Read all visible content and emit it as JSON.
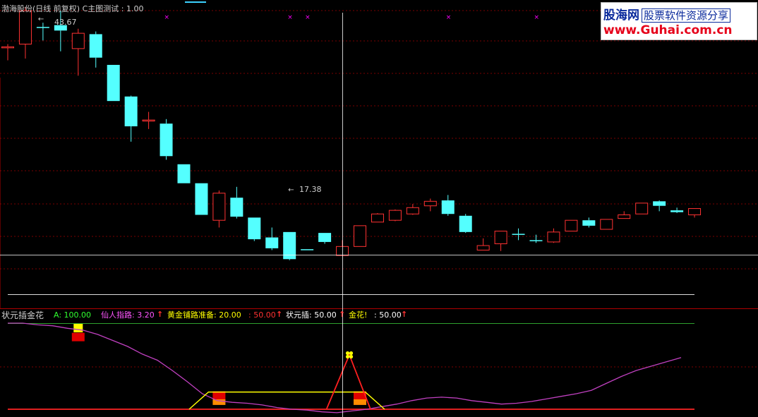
{
  "main_title": "渤海股份(日线 前复权) C主图测试 : 1.00",
  "high_label": "43.67",
  "low_label": "17.38",
  "indicator": {
    "name": "状元插金花",
    "a_label": "A: 100.00",
    "xianren_label": "仙人指路: 3.20",
    "huangjin_label": "黄金铺路准备: 20.00",
    "huangjin_val2": ": 50.00",
    "zhuangyuan_label": "状元插: 50.00",
    "jinhua_label": "金花!",
    "jinhua_val": ": 50.00"
  },
  "logo": {
    "brand": "股海网",
    "slogan": "股票软件资源分享",
    "url": "www.Guhai.com.cn"
  },
  "colors": {
    "up": "#ff3232",
    "down": "#54ffff",
    "grid": "#7a0000",
    "crosshair": "#ffffff",
    "magenta": "#ff00ff",
    "yellow": "#ffff00"
  },
  "chart_data": {
    "type": "candlestick",
    "price_range": [
      12.6,
      45.4
    ],
    "candles": [
      {
        "o": 41.0,
        "c": 41.0,
        "h": 41.3,
        "l": 39.5,
        "dir": "up"
      },
      {
        "o": 41.3,
        "c": 45.0,
        "h": 45.4,
        "l": 39.7,
        "dir": "up"
      },
      {
        "o": 43.2,
        "c": 43.2,
        "h": 43.67,
        "l": 41.7,
        "dir": "down"
      },
      {
        "o": 43.4,
        "c": 42.8,
        "h": 45.0,
        "l": 40.5,
        "dir": "down"
      },
      {
        "o": 40.8,
        "c": 42.5,
        "h": 43.0,
        "l": 37.8,
        "dir": "up"
      },
      {
        "o": 42.4,
        "c": 39.8,
        "h": 42.7,
        "l": 38.7,
        "dir": "down"
      },
      {
        "o": 39.0,
        "c": 35.0,
        "h": 39.0,
        "l": 35.0,
        "dir": "down"
      },
      {
        "o": 35.5,
        "c": 32.2,
        "h": 35.6,
        "l": 30.5,
        "dir": "down"
      },
      {
        "o": 32.9,
        "c": 32.9,
        "h": 33.8,
        "l": 31.9,
        "dir": "up"
      },
      {
        "o": 32.5,
        "c": 28.9,
        "h": 33.0,
        "l": 28.5,
        "dir": "down"
      },
      {
        "o": 28.0,
        "c": 25.9,
        "h": 28.0,
        "l": 25.9,
        "dir": "down"
      },
      {
        "o": 25.9,
        "c": 22.4,
        "h": 25.9,
        "l": 22.4,
        "dir": "down"
      },
      {
        "o": 21.8,
        "c": 24.8,
        "h": 25.1,
        "l": 21.0,
        "dir": "up"
      },
      {
        "o": 24.3,
        "c": 22.2,
        "h": 25.5,
        "l": 22.0,
        "dir": "down"
      },
      {
        "o": 22.1,
        "c": 19.7,
        "h": 22.1,
        "l": 19.5,
        "dir": "down"
      },
      {
        "o": 19.9,
        "c": 18.7,
        "h": 21.0,
        "l": 18.5,
        "dir": "down"
      },
      {
        "o": 20.5,
        "c": 17.5,
        "h": 20.5,
        "l": 17.38,
        "dir": "down"
      },
      {
        "o": 18.6,
        "c": 18.6,
        "h": 18.6,
        "l": 18.6,
        "dir": "down"
      },
      {
        "o": 20.4,
        "c": 19.4,
        "h": 20.4,
        "l": 19.2,
        "dir": "down"
      },
      {
        "o": 17.9,
        "c": 18.9,
        "h": 19.6,
        "l": 17.9,
        "dir": "up"
      },
      {
        "o": 18.9,
        "c": 21.2,
        "h": 21.2,
        "l": 18.9,
        "dir": "up"
      },
      {
        "o": 21.6,
        "c": 22.5,
        "h": 22.6,
        "l": 21.6,
        "dir": "up"
      },
      {
        "o": 21.8,
        "c": 22.9,
        "h": 23.0,
        "l": 21.7,
        "dir": "up"
      },
      {
        "o": 22.5,
        "c": 23.2,
        "h": 23.6,
        "l": 22.4,
        "dir": "up"
      },
      {
        "o": 23.4,
        "c": 23.9,
        "h": 24.2,
        "l": 22.8,
        "dir": "up"
      },
      {
        "o": 24.0,
        "c": 22.5,
        "h": 24.6,
        "l": 22.3,
        "dir": "down"
      },
      {
        "o": 22.3,
        "c": 20.5,
        "h": 22.5,
        "l": 20.4,
        "dir": "down"
      },
      {
        "o": 18.5,
        "c": 19.0,
        "h": 19.8,
        "l": 18.5,
        "dir": "up"
      },
      {
        "o": 19.2,
        "c": 20.6,
        "h": 20.6,
        "l": 18.4,
        "dir": "up"
      },
      {
        "o": 20.3,
        "c": 20.3,
        "h": 20.9,
        "l": 19.6,
        "dir": "down"
      },
      {
        "o": 19.6,
        "c": 19.6,
        "h": 20.2,
        "l": 19.3,
        "dir": "down"
      },
      {
        "o": 19.4,
        "c": 20.5,
        "h": 20.9,
        "l": 19.3,
        "dir": "up"
      },
      {
        "o": 20.6,
        "c": 21.8,
        "h": 21.8,
        "l": 20.6,
        "dir": "up"
      },
      {
        "o": 21.8,
        "c": 21.2,
        "h": 22.1,
        "l": 21.0,
        "dir": "down"
      },
      {
        "o": 20.8,
        "c": 21.9,
        "h": 21.9,
        "l": 20.8,
        "dir": "up"
      },
      {
        "o": 22.0,
        "c": 22.4,
        "h": 22.8,
        "l": 22.0,
        "dir": "up"
      },
      {
        "o": 22.5,
        "c": 23.7,
        "h": 23.7,
        "l": 22.5,
        "dir": "up"
      },
      {
        "o": 23.9,
        "c": 23.4,
        "h": 24.0,
        "l": 22.8,
        "dir": "down"
      },
      {
        "o": 22.9,
        "c": 22.7,
        "h": 23.2,
        "l": 22.6,
        "dir": "down"
      },
      {
        "o": 22.4,
        "c": 23.1,
        "h": 23.1,
        "l": 22.1,
        "dir": "up"
      }
    ],
    "marks_x_indices": [
      9,
      16,
      17,
      25,
      30
    ],
    "indicator_range": [
      0,
      100
    ],
    "magenta_line": [
      100,
      100,
      98,
      97,
      94,
      92,
      87,
      80,
      73,
      64,
      57,
      45,
      32,
      18,
      10,
      8,
      7,
      5,
      2,
      0,
      -1,
      -3,
      -4,
      -2,
      0,
      3,
      6,
      10,
      13,
      14,
      13,
      10,
      8,
      6,
      7,
      9,
      12,
      15,
      18,
      22,
      30,
      38,
      45,
      50,
      55,
      60
    ],
    "yellow_trapezoid": {
      "start": 10.3,
      "rise_end": 11.4,
      "fall_start": 20.3,
      "end": 21.4,
      "level": 20
    },
    "red_spike": {
      "start": 18.1,
      "peak": 19.4,
      "end": 20.6,
      "level": 50
    },
    "yellow_blocks": [
      {
        "index": 4,
        "level": 100
      }
    ],
    "red_blocks": [
      {
        "index": 4,
        "level": 88
      },
      {
        "index": 12,
        "level": 20
      },
      {
        "index": 20,
        "level": 20
      }
    ],
    "orange_blocks": [
      {
        "index": 12,
        "level": 5
      },
      {
        "index": 20,
        "level": 5
      }
    ],
    "crosshair_index": 19,
    "crosshair_price": 18.0
  }
}
